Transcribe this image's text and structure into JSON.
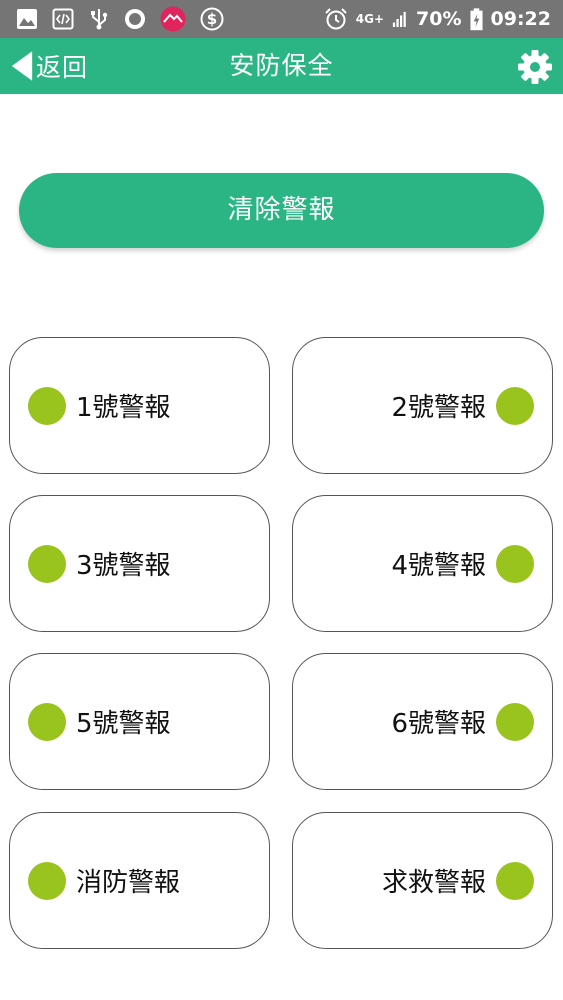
{
  "status_bar": {
    "network": "4G+",
    "battery": "70%",
    "time": "09:22",
    "left_icons": [
      "image-icon",
      "code-icon",
      "usb-icon",
      "record-icon",
      "mountain-app-icon",
      "dollar-icon"
    ],
    "right_icons": [
      "alarm-icon",
      "signal-icon",
      "battery-icon"
    ]
  },
  "app_bar": {
    "back_label": "返回",
    "title": "安防保全",
    "color": "#2bb584"
  },
  "clear_button": {
    "label": "清除警報"
  },
  "alarms": [
    {
      "label": "1號警報",
      "status_color": "#99c31d"
    },
    {
      "label": "2號警報",
      "status_color": "#99c31d"
    },
    {
      "label": "3號警報",
      "status_color": "#99c31d"
    },
    {
      "label": "4號警報",
      "status_color": "#99c31d"
    },
    {
      "label": "5號警報",
      "status_color": "#99c31d"
    },
    {
      "label": "6號警報",
      "status_color": "#99c31d"
    },
    {
      "label": "消防警報",
      "status_color": "#99c31d"
    },
    {
      "label": "求救警報",
      "status_color": "#99c31d"
    }
  ]
}
